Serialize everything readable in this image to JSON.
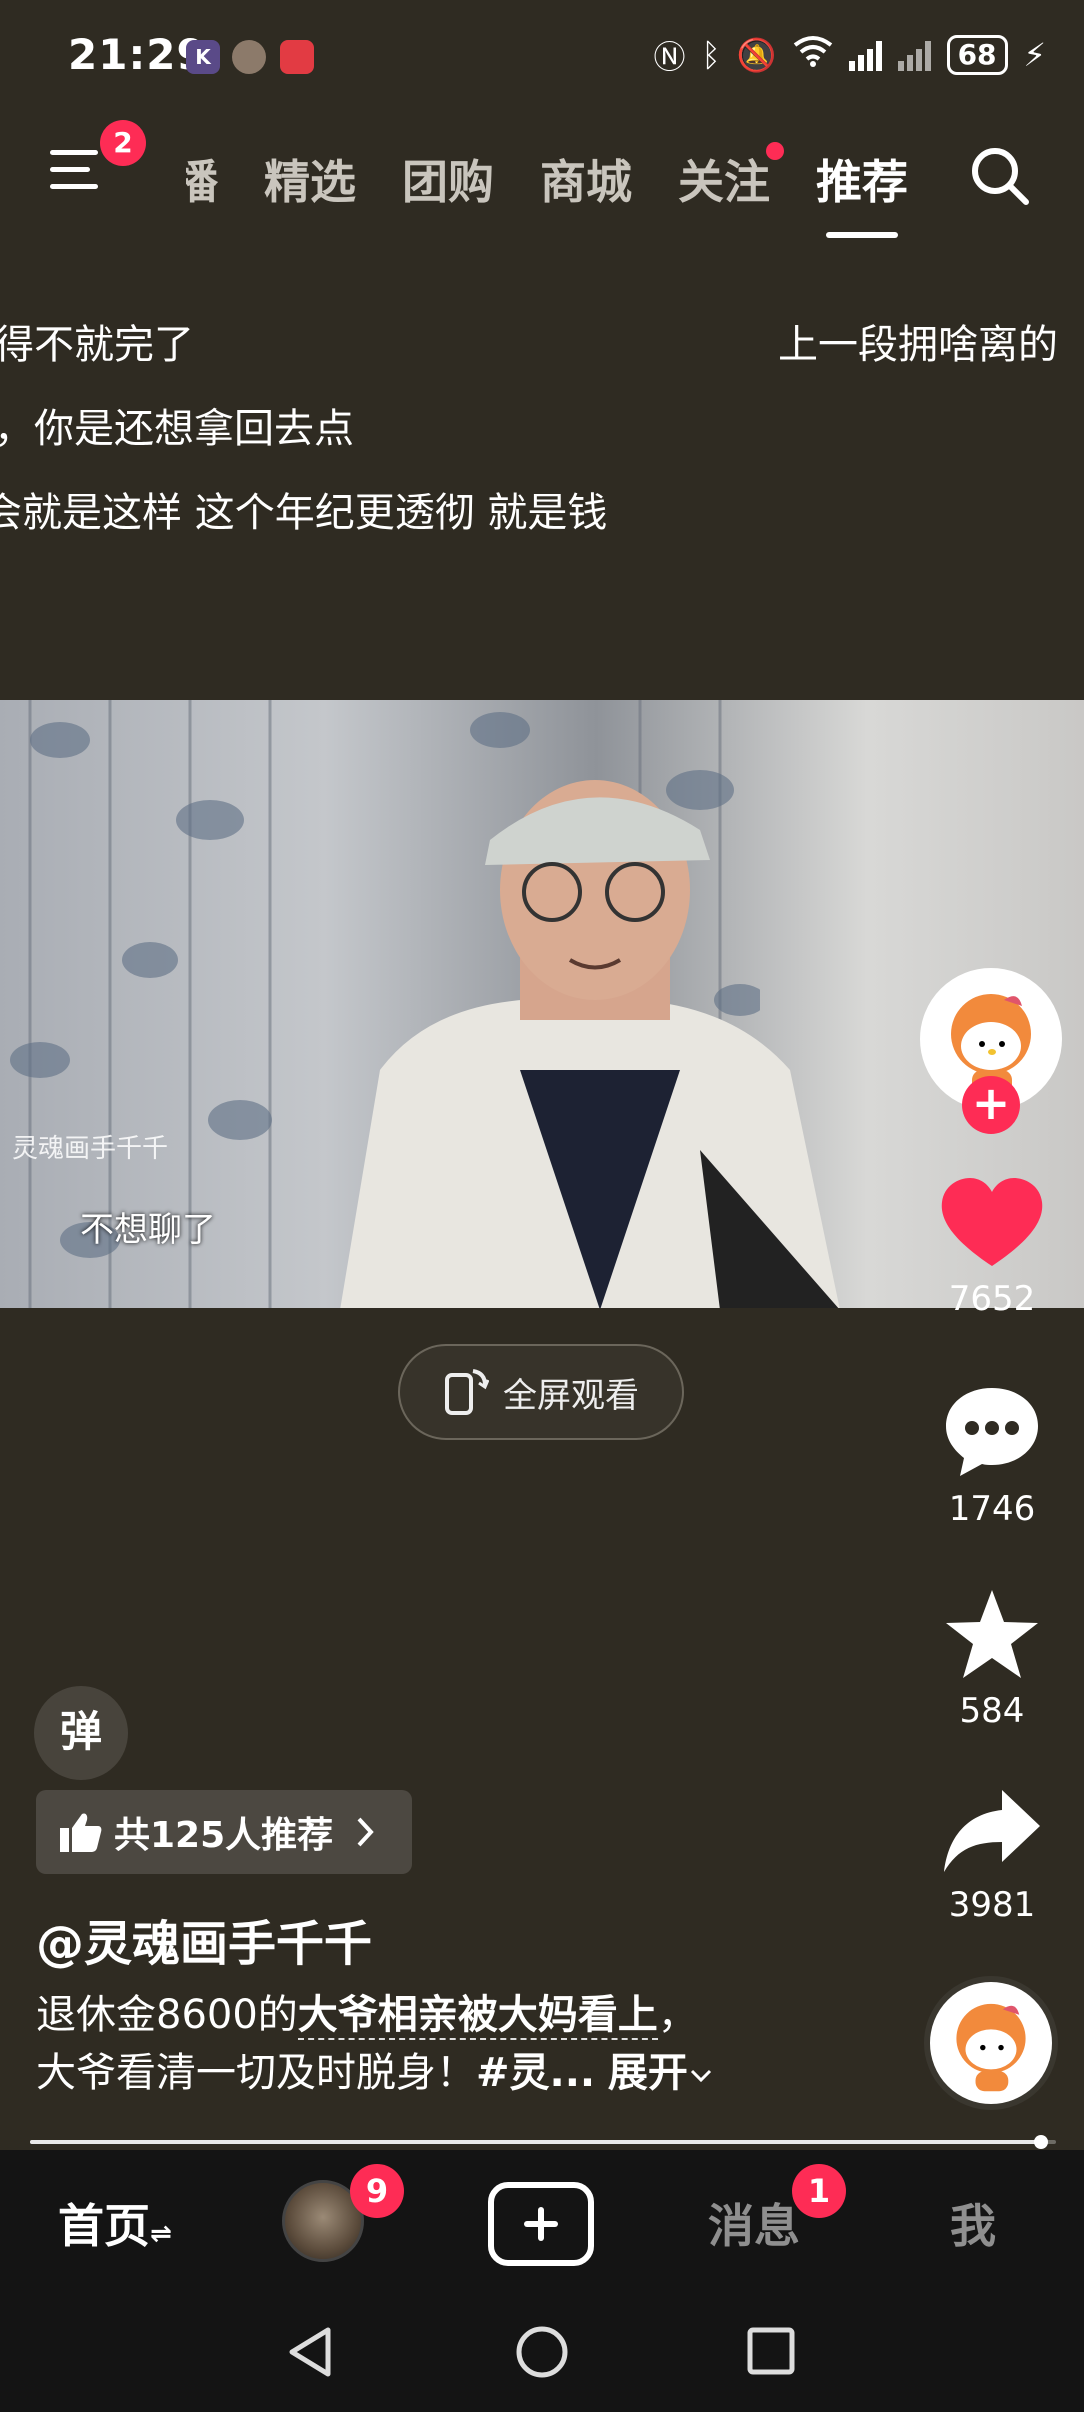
{
  "status_bar": {
    "time": "21:29",
    "app_icon_k": "K",
    "battery": "68"
  },
  "top_nav": {
    "menu_badge": "2",
    "tabs": [
      "直播",
      "精选",
      "团购",
      "商城",
      "关注",
      "推荐"
    ],
    "active_tab": "推荐"
  },
  "danmaku": {
    "line1_left": "得不就完了",
    "line1_right": "上一段拥啥离的",
    "line2": "，你是还想拿回去点",
    "line3": "会就是这样 这个年纪更透彻 就是钱"
  },
  "video": {
    "watermark": "灵魂画手千千",
    "subtitle": "不想聊了"
  },
  "fullscreen_button": "全屏观看",
  "right_rail": {
    "like_count": "7652",
    "comment_count": "1746",
    "favorite_count": "584",
    "share_count": "3981"
  },
  "danmaku_toggle": "弹",
  "recommend_pill": "共125人推荐",
  "author": "@灵魂画手千千",
  "description": {
    "prefix": "退休金8600的",
    "highlight": "大爷相亲被大妈看上",
    "suffix": "，",
    "line2": "大爷看清一切及时脱身！",
    "tag": "#灵...",
    "expand": "展开"
  },
  "progress": {
    "fraction": 0.985
  },
  "bottom_tabs": {
    "home": "首页",
    "friends_badge": "9",
    "messages": "消息",
    "messages_badge": "1",
    "me": "我"
  },
  "colors": {
    "background": "#2f2b22",
    "accent": "#fe2c55",
    "tab_bar": "#141414"
  }
}
